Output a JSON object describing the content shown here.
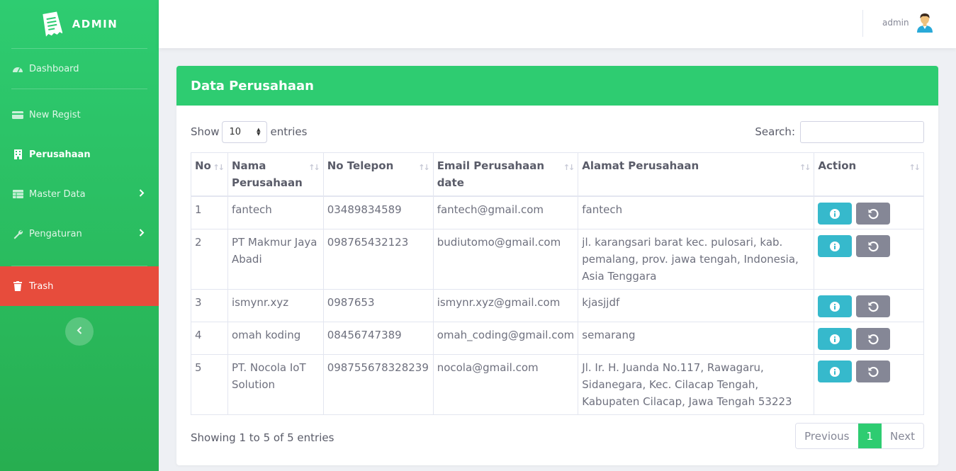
{
  "brand": {
    "title": "ADMIN",
    "icon": "receipt-icon"
  },
  "sidebar": {
    "items": [
      {
        "label": "Dashboard",
        "icon": "gauge-icon"
      },
      {
        "label": "New Regist",
        "icon": "card-icon"
      },
      {
        "label": "Perusahaan",
        "icon": "building-icon",
        "active": true
      },
      {
        "label": "Master Data",
        "icon": "table-icon",
        "has_children": true
      },
      {
        "label": "Pengaturan",
        "icon": "wrench-icon",
        "has_children": true
      },
      {
        "label": "Trash",
        "icon": "trash-icon"
      }
    ],
    "toggle_icon": "chevron-left-icon"
  },
  "topbar": {
    "user_name": "admin",
    "avatar_icon": "user-avatar-icon"
  },
  "card": {
    "title": "Data Perusahaan"
  },
  "controls": {
    "show_label": "Show",
    "entries_value": "10",
    "entries_label": "entries",
    "search_label": "Search:",
    "search_value": ""
  },
  "table": {
    "columns": [
      "No",
      "Nama Perusahaan",
      "No Telepon",
      "Email Perusahaan date",
      "Alamat Perusahaan",
      "Action"
    ],
    "rows": [
      {
        "no": "1",
        "nama": "fantech",
        "telepon": "03489834589",
        "email": "fantech@gmail.com",
        "alamat": "fantech"
      },
      {
        "no": "2",
        "nama": "PT Makmur Jaya Abadi",
        "telepon": "098765432123",
        "email": "budiutomo@gmail.com",
        "alamat": "jl. karangsari barat kec. pulosari, kab. pemalang, prov. jawa tengah, Indonesia, Asia Tenggara"
      },
      {
        "no": "3",
        "nama": "ismynr.xyz",
        "telepon": "0987653",
        "email": "ismynr.xyz@gmail.com",
        "alamat": "kjasjjdf"
      },
      {
        "no": "4",
        "nama": "omah koding",
        "telepon": "08456747389",
        "email": "omah_coding@gmail.com",
        "alamat": "semarang"
      },
      {
        "no": "5",
        "nama": "PT. Nocola IoT Solution",
        "telepon": "098755678328239",
        "email": "nocola@gmail.com",
        "alamat": "Jl. Ir. H. Juanda No.117, Rawagaru, Sidanegara, Kec. Cilacap Tengah, Kabupaten Cilacap, Jawa Tengah 53223"
      }
    ],
    "action_icons": [
      "info-icon",
      "restore-icon"
    ]
  },
  "footer": {
    "info": "Showing 1 to 5 of 5 entries",
    "previous": "Previous",
    "current_page": "1",
    "next": "Next"
  },
  "colors": {
    "primary": "#2ecc71",
    "danger": "#e74c3c",
    "info": "#36b9cc",
    "secondary": "#858796"
  }
}
